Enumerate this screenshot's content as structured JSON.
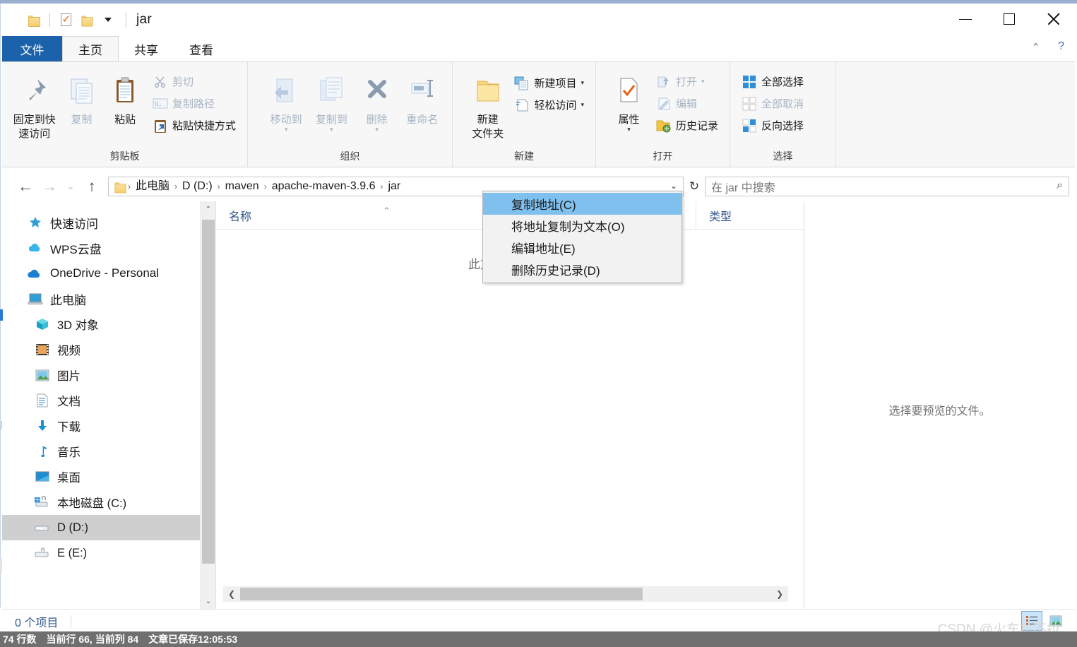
{
  "window": {
    "title": "jar",
    "quick_access": [
      {
        "name": "folder-icon",
        "label": "folder"
      },
      {
        "name": "properties-icon",
        "label": "properties"
      },
      {
        "name": "new-folder-icon",
        "label": "new folder"
      },
      {
        "name": "customize-dropdown-icon",
        "label": "customize"
      }
    ],
    "controls": {
      "minimize": "—",
      "maximize": "▢",
      "close": "✕"
    }
  },
  "ribbon": {
    "tabs": [
      {
        "label": "文件",
        "state": "file"
      },
      {
        "label": "主页",
        "state": "active"
      },
      {
        "label": "共享",
        "state": "normal"
      },
      {
        "label": "查看",
        "state": "normal"
      }
    ],
    "collapse_icon": "⌃",
    "help_icon": "?",
    "groups": [
      {
        "label": "剪贴板",
        "big": [
          {
            "label": "固定到快",
            "label2": "速访问",
            "icon": "pin-icon",
            "disabled": false
          },
          {
            "label": "复制",
            "icon": "copy-icon",
            "disabled": true
          },
          {
            "label": "粘贴",
            "icon": "paste-icon",
            "disabled": false
          }
        ],
        "small": [
          {
            "label": "剪切",
            "icon": "scissors-icon",
            "disabled": true
          },
          {
            "label": "复制路径",
            "icon": "copy-path-icon",
            "disabled": true
          },
          {
            "label": "粘贴快捷方式",
            "icon": "paste-shortcut-icon",
            "disabled": false
          }
        ]
      },
      {
        "label": "组织",
        "big": [
          {
            "label": "移动到",
            "icon": "move-to-icon",
            "disabled": true,
            "dropdown": true
          },
          {
            "label": "复制到",
            "icon": "copy-to-icon",
            "disabled": true,
            "dropdown": true
          },
          {
            "label": "删除",
            "icon": "delete-icon",
            "disabled": true,
            "dropdown": true
          },
          {
            "label": "重命名",
            "icon": "rename-icon",
            "disabled": true
          }
        ],
        "small": []
      },
      {
        "label": "新建",
        "big": [
          {
            "label": "新建",
            "label2": "文件夹",
            "icon": "new-folder-icon",
            "disabled": false
          }
        ],
        "small": [
          {
            "label": "新建项目",
            "icon": "new-item-icon",
            "disabled": false,
            "dropdown": true
          },
          {
            "label": "轻松访问",
            "icon": "easy-access-icon",
            "disabled": false,
            "dropdown": true
          }
        ]
      },
      {
        "label": "打开",
        "big": [
          {
            "label": "属性",
            "icon": "properties-icon",
            "disabled": false,
            "dropdown": true
          }
        ],
        "small": [
          {
            "label": "打开",
            "icon": "open-icon",
            "disabled": true,
            "dropdown": true
          },
          {
            "label": "编辑",
            "icon": "edit-icon",
            "disabled": true
          },
          {
            "label": "历史记录",
            "icon": "history-icon",
            "disabled": false
          }
        ]
      },
      {
        "label": "选择",
        "big": [],
        "small": [
          {
            "label": "全部选择",
            "icon": "select-all-icon",
            "disabled": false
          },
          {
            "label": "全部取消",
            "icon": "select-none-icon",
            "disabled": true
          },
          {
            "label": "反向选择",
            "icon": "invert-selection-icon",
            "disabled": false
          }
        ]
      }
    ]
  },
  "address_bar": {
    "back_icon": "←",
    "forward_icon": "→",
    "recent_icon": "⌄",
    "up_icon": "↑",
    "folder_icon": "folder-icon",
    "breadcrumbs": [
      "此电脑",
      "D (D:)",
      "maven",
      "apache-maven-3.9.6",
      "jar"
    ],
    "separator": "›",
    "dropdown_icon": "⌄",
    "refresh_icon": "↻"
  },
  "search": {
    "placeholder": "在 jar 中搜索",
    "icon": "search-icon"
  },
  "nav_pane": {
    "items": [
      {
        "label": "快速访问",
        "icon": "star-pin-icon",
        "indent": 0,
        "selected": false
      },
      {
        "label": "WPS云盘",
        "icon": "wps-cloud-icon",
        "indent": 0,
        "selected": false
      },
      {
        "label": "OneDrive - Personal",
        "icon": "onedrive-icon",
        "indent": 0,
        "selected": false
      },
      {
        "label": "此电脑",
        "icon": "this-pc-icon",
        "indent": 0,
        "selected": false
      },
      {
        "label": "3D 对象",
        "icon": "3d-objects-icon",
        "indent": 1,
        "selected": false
      },
      {
        "label": "视频",
        "icon": "videos-icon",
        "indent": 1,
        "selected": false
      },
      {
        "label": "图片",
        "icon": "pictures-icon",
        "indent": 1,
        "selected": false
      },
      {
        "label": "文档",
        "icon": "documents-icon",
        "indent": 1,
        "selected": false
      },
      {
        "label": "下载",
        "icon": "downloads-icon",
        "indent": 1,
        "selected": false
      },
      {
        "label": "音乐",
        "icon": "music-icon",
        "indent": 1,
        "selected": false
      },
      {
        "label": "桌面",
        "icon": "desktop-icon",
        "indent": 1,
        "selected": false
      },
      {
        "label": "本地磁盘 (C:)",
        "icon": "system-drive-icon",
        "indent": 1,
        "selected": false
      },
      {
        "label": "D (D:)",
        "icon": "drive-icon",
        "indent": 1,
        "selected": true
      },
      {
        "label": "E (E:)",
        "icon": "drive-lock-icon",
        "indent": 1,
        "selected": false
      }
    ],
    "scroll_up_icon": "⌃",
    "scroll_down_icon": "⌄"
  },
  "file_list": {
    "columns": [
      {
        "label": "名称",
        "sorted": true
      },
      {
        "label": "类型",
        "sorted": false
      }
    ],
    "sort_caret": "⌃",
    "empty_message": "此文件夹为空。",
    "hscroll": {
      "left_icon": "❮",
      "right_icon": "❯"
    }
  },
  "preview_pane": {
    "message": "选择要预览的文件。"
  },
  "context_menu": {
    "items": [
      {
        "label": "复制地址(C)",
        "selected": true
      },
      {
        "label": "将地址复制为文本(O)",
        "selected": false
      },
      {
        "label": "编辑地址(E)",
        "selected": false
      },
      {
        "label": "删除历史记录(D)",
        "selected": false
      }
    ]
  },
  "status_bar": {
    "item_count": "0 个项目",
    "view_details_icon": "details-view-icon",
    "view_large_icons_icon": "large-icons-view-icon"
  },
  "background_strip": {
    "lines": "74 行数",
    "cursor": "当前行 66, 当前列 84",
    "saved": "文章已保存12:05:53"
  },
  "watermark": "CSDN @火车拉不拉"
}
